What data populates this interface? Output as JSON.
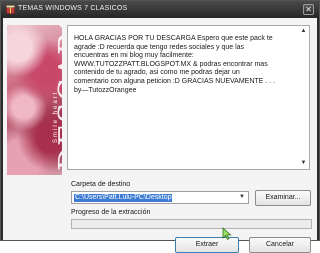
{
  "window": {
    "title": "TEMAS WINDOWS 7 CLASICOS",
    "close_glyph": "✕"
  },
  "banner": {
    "word": "DESCARGA",
    "sub": "Smile heart"
  },
  "message": {
    "text": "HOLA GRACIAS POR TU DESCARGA Espero que este pack te\nagrade :D recuerda que tengo redes sociales y que las\nencuentras en mi blog muy facilmente:\nWWW.TUTOZZPATT.BLOGSPOT.MX & podras encontrar mas\ncontenido de tu agrado, asi como me podras dejar un\ncomentario con alguna peticion :D GRACIAS NUEVAMENTE . . .\nby—TutozzOrangee"
  },
  "destination": {
    "label": "Carpeta de destino",
    "value": "C:\\Users\\Patt.Lulu-PC\\Desktop",
    "browse_label": "Examinar..."
  },
  "progress": {
    "label": "Progreso de la extracción",
    "percent": 0
  },
  "buttons": {
    "extract_label": "Extraer",
    "cancel_label": "Cancelar"
  },
  "icons": {
    "title_icon": "winrar-sfx-icon",
    "dropdown": "chevron-down-icon",
    "scroll_up": "scroll-up-icon",
    "scroll_down": "scroll-down-icon",
    "cursor": "mouse-pointer-icon"
  },
  "colors": {
    "title_bar": "#262626",
    "selection": "#3d7bd5",
    "progress": "#3dbb3d",
    "default_button_border": "#3c7fb1"
  }
}
